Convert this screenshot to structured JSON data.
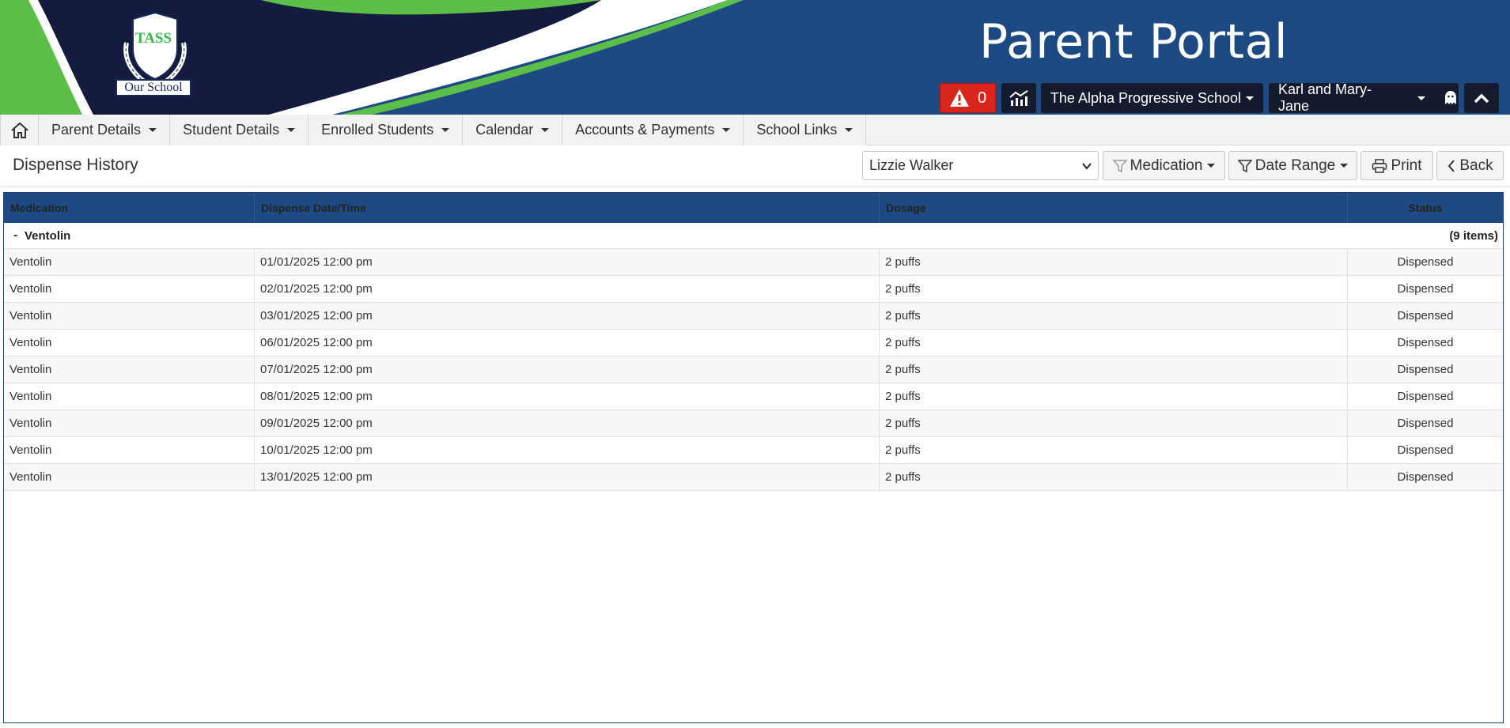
{
  "header": {
    "portal_title": "Parent Portal",
    "logo_text": "TASS",
    "logo_label": "Our School",
    "alert_count": "0",
    "school_name": "The Alpha Progressive School",
    "user_name": "Karl and Mary-Jane",
    "icons": {
      "alert": "warning-triangle-icon",
      "chart": "analytics-chart-icon",
      "ghost": "ghost-icon",
      "collapse": "chevron-up-icon"
    },
    "colors": {
      "header_bg": "#1d4a82",
      "alert_red": "#d9261c",
      "brand_green": "#3bb54a",
      "dark_navy": "#141b2e"
    }
  },
  "nav": {
    "items": [
      {
        "label": "Parent Details"
      },
      {
        "label": "Student Details"
      },
      {
        "label": "Enrolled Students"
      },
      {
        "label": "Calendar"
      },
      {
        "label": "Accounts & Payments"
      },
      {
        "label": "School Links"
      }
    ]
  },
  "toolbar": {
    "page_title": "Dispense History",
    "selected_student": "Lizzie Walker",
    "medication_label": "Medication",
    "date_range_label": "Date Range",
    "print_label": "Print",
    "back_label": "Back"
  },
  "grid": {
    "columns": [
      "Medication",
      "Dispense Date/Time",
      "Dosage",
      "Status"
    ],
    "group": {
      "toggle": "-",
      "label": "Ventolin",
      "count": "(9 items)"
    },
    "rows": [
      {
        "medication": "Ventolin",
        "datetime": "01/01/2025 12:00 pm",
        "dosage": "2 puffs",
        "status": "Dispensed"
      },
      {
        "medication": "Ventolin",
        "datetime": "02/01/2025 12:00 pm",
        "dosage": "2 puffs",
        "status": "Dispensed"
      },
      {
        "medication": "Ventolin",
        "datetime": "03/01/2025 12:00 pm",
        "dosage": "2 puffs",
        "status": "Dispensed"
      },
      {
        "medication": "Ventolin",
        "datetime": "06/01/2025 12:00 pm",
        "dosage": "2 puffs",
        "status": "Dispensed"
      },
      {
        "medication": "Ventolin",
        "datetime": "07/01/2025 12:00 pm",
        "dosage": "2 puffs",
        "status": "Dispensed"
      },
      {
        "medication": "Ventolin",
        "datetime": "08/01/2025 12:00 pm",
        "dosage": "2 puffs",
        "status": "Dispensed"
      },
      {
        "medication": "Ventolin",
        "datetime": "09/01/2025 12:00 pm",
        "dosage": "2 puffs",
        "status": "Dispensed"
      },
      {
        "medication": "Ventolin",
        "datetime": "10/01/2025 12:00 pm",
        "dosage": "2 puffs",
        "status": "Dispensed"
      },
      {
        "medication": "Ventolin",
        "datetime": "13/01/2025 12:00 pm",
        "dosage": "2 puffs",
        "status": "Dispensed"
      }
    ]
  }
}
